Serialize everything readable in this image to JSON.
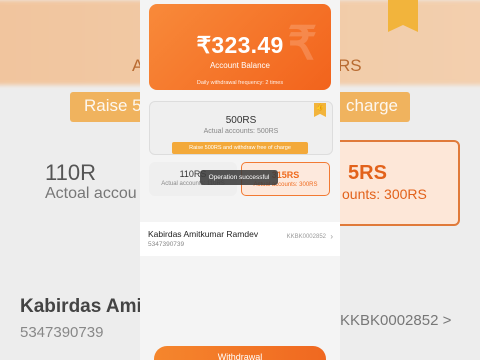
{
  "balance": {
    "amount": "₹323.49",
    "label": "Account Balance",
    "frequency": "Daily withdrawal frequency: 2 times",
    "deco": "₹"
  },
  "options": {
    "main": {
      "amount": "500RS",
      "actual": "Actual accounts: 500RS",
      "promo": "Raise 500RS and withdraw free of charge"
    },
    "left": {
      "amount": "110RS",
      "actual": "Actual accounts: 110RS"
    },
    "right": {
      "amount": "315RS",
      "actual": "Actual accounts: 300RS"
    }
  },
  "toast": "Operation successful",
  "account": {
    "name": "Kabirdas Amitkumar Ramdev",
    "number": "5347390739",
    "code": "KKBK0002852",
    "chevron": "›"
  },
  "withdraw_button": "Withdrawal",
  "background": {
    "left_label": "Ac",
    "right_label": "RS",
    "strip_left": "Raise 50",
    "strip_right": "charge",
    "big_amount_left": "110R",
    "big_actual_left": "Actoal accou",
    "right_amount": "5RS",
    "right_actual": "ounts: 300RS",
    "name": "Kabirdas Ami",
    "number": "5347390739",
    "code": "KKBK0002852 >"
  },
  "colors": {
    "accent": "#f2631c",
    "promo": "#f3a93a"
  }
}
